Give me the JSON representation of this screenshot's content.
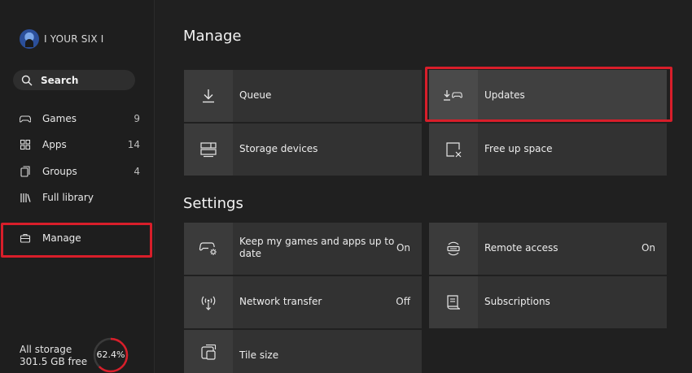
{
  "profile": {
    "gamertag": "I YOUR SIX I"
  },
  "search": {
    "label": "Search"
  },
  "sidebar": {
    "items": [
      {
        "label": "Games",
        "count": "9",
        "icon": "controller-icon"
      },
      {
        "label": "Apps",
        "count": "14",
        "icon": "apps-grid-icon"
      },
      {
        "label": "Groups",
        "count": "4",
        "icon": "groups-icon"
      },
      {
        "label": "Full library",
        "count": "",
        "icon": "library-icon"
      }
    ],
    "manage_label": "Manage"
  },
  "storage": {
    "title": "All storage",
    "free": "301.5 GB free",
    "percent_text": "62.4%",
    "percent": 62.4
  },
  "main": {
    "manage_title": "Manage",
    "settings_title": "Settings",
    "manage_tiles": [
      {
        "label": "Queue",
        "icon": "download-icon"
      },
      {
        "label": "Updates",
        "icon": "download-controller-icon"
      },
      {
        "label": "Storage devices",
        "icon": "storage-icon"
      },
      {
        "label": "Free up space",
        "icon": "free-space-icon"
      }
    ],
    "settings_tiles": [
      {
        "label_line1": "Keep my games and apps up to",
        "label_line2": "date",
        "value": "On",
        "icon": "controller-gear-icon"
      },
      {
        "label": "Remote access",
        "value": "On",
        "icon": "remote-access-icon"
      },
      {
        "label": "Network transfer",
        "value": "Off",
        "icon": "network-transfer-icon"
      },
      {
        "label": "Subscriptions",
        "value": "",
        "icon": "subscriptions-icon"
      },
      {
        "label": "Tile size",
        "value": "",
        "icon": "tile-size-icon"
      }
    ]
  },
  "colors": {
    "highlight": "#d81e2a",
    "background": "#202020",
    "tile": "#323232"
  }
}
